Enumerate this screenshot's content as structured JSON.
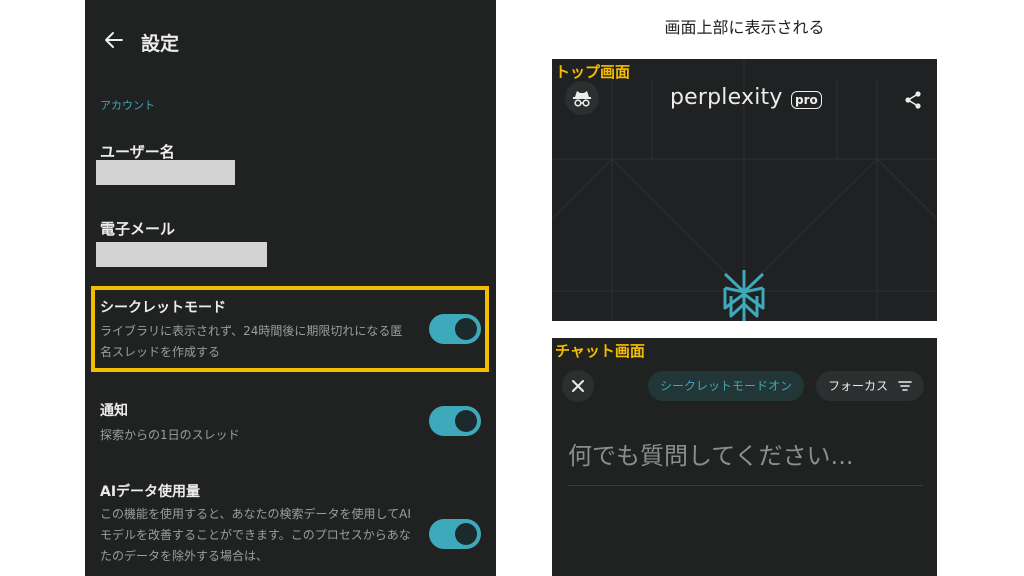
{
  "settings": {
    "title": "設定",
    "account_section": "アカウント",
    "username_label": "ユーザー名",
    "email_label": "電子メール",
    "items": [
      {
        "title": "シークレットモード",
        "description": "ライブラリに表示されず、24時間後に期限切れになる匿名スレッドを作成する",
        "enabled": true
      },
      {
        "title": "通知",
        "description": "探索からの1日のスレッド",
        "enabled": true
      },
      {
        "title": "AIデータ使用量",
        "description": "この機能を使用すると、あなたの検索データを使用してAIモデルを改善することができます。このプロセスからあなたのデータを除外する場合は、",
        "enabled": true
      }
    ]
  },
  "caption": "画面上部に表示される",
  "top_screen": {
    "tag": "トップ画面",
    "logo": "perplexity",
    "badge": "pro"
  },
  "chat_screen": {
    "tag": "チャット画面",
    "incognito_label": "シークレットモードオン",
    "focus_label": "フォーカス",
    "prompt_placeholder": "何でも質問してください..."
  },
  "colors": {
    "accent": "#3ea9ba",
    "highlight": "#f5bd00",
    "panel_bg": "#202222"
  },
  "icons": [
    "back-arrow-icon",
    "incognito-icon",
    "share-icon",
    "perplexity-logo-mark",
    "close-icon",
    "filter-icon"
  ]
}
